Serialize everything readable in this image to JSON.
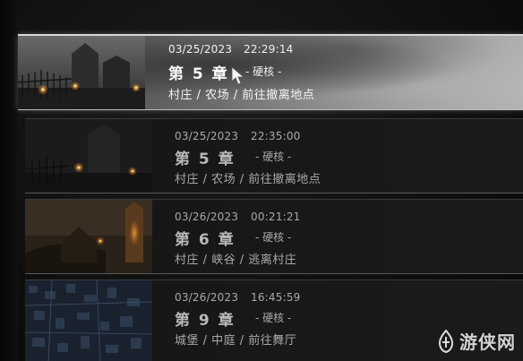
{
  "save_slots": [
    {
      "date": "03/25/2023",
      "time": "22:29:14",
      "chapter": "第 5 章",
      "difficulty": "- 硬核 -",
      "location": "村庄 / 农场 / 前往撤离地点",
      "selected": true
    },
    {
      "date": "03/25/2023",
      "time": "22:35:00",
      "chapter": "第 5 章",
      "difficulty": "- 硬核 -",
      "location": "村庄 / 农场 / 前往撤离地点",
      "selected": false
    },
    {
      "date": "03/26/2023",
      "time": "00:21:21",
      "chapter": "第 6 章",
      "difficulty": "- 硬核 -",
      "location": "村庄 / 峡谷 / 逃离村庄",
      "selected": false
    },
    {
      "date": "03/26/2023",
      "time": "16:45:59",
      "chapter": "第 9 章",
      "difficulty": "- 硬核 -",
      "location": "城堡 / 中庭 / 前往舞厅",
      "selected": false
    }
  ],
  "watermark": {
    "text": "游侠网",
    "logo_icon": "ali213-logo-icon"
  },
  "colors": {
    "selected_highlight": "#9a9a9a",
    "slot_background": "#161616",
    "text_primary": "#f2f2f2",
    "text_dim": "#a9a9a9",
    "lantern_glow": "#f0a040"
  }
}
